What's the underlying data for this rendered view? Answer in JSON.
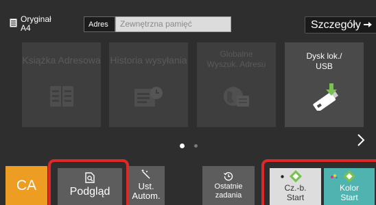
{
  "original": {
    "label": "Oryginał",
    "size": "A4",
    "icon": "document-icon"
  },
  "address": {
    "label": "Adres",
    "placeholder": "Zewnętrzna pamięć"
  },
  "details_button": {
    "label": "Szczegóły",
    "icon": "arrow-right-icon"
  },
  "tiles": [
    {
      "label": "Książka Adresowa",
      "icon": "address-book-icon",
      "enabled": false
    },
    {
      "label": "Historia wysyłania",
      "icon": "send-history-icon",
      "enabled": false
    },
    {
      "label_line1": "Globalne",
      "label_line2": "Wyszuk. Adresu",
      "icon": "global-address-search-icon",
      "enabled": false
    },
    {
      "label_line1": "Dysk lok./",
      "label_line2": "USB",
      "icon": "usb-drive-icon",
      "enabled": true
    }
  ],
  "pager": {
    "current_page": 1,
    "total_pages": 2
  },
  "bottom": {
    "ca_label": "CA",
    "preview": {
      "label": "Podgląd",
      "icon": "preview-icon"
    },
    "auto_settings": {
      "line1": "Ust.",
      "line2": "Autom.",
      "icon": "auto-wand-icon"
    },
    "recent_jobs": {
      "line1": "Ostatnie",
      "line2": "zadania",
      "icon": "history-clock-icon"
    },
    "start_bw": {
      "line1": "Cz.-b.",
      "line2": "Start",
      "icon": "start-diamond-icon"
    },
    "start_color": {
      "line1": "Kolor",
      "line2": "Start",
      "icon": "start-diamond-icon"
    }
  },
  "colors": {
    "ca": "#ec9d22",
    "start_color": "#4fb3b0",
    "start_diamond": "#79c250",
    "highlight": "#e12828"
  }
}
